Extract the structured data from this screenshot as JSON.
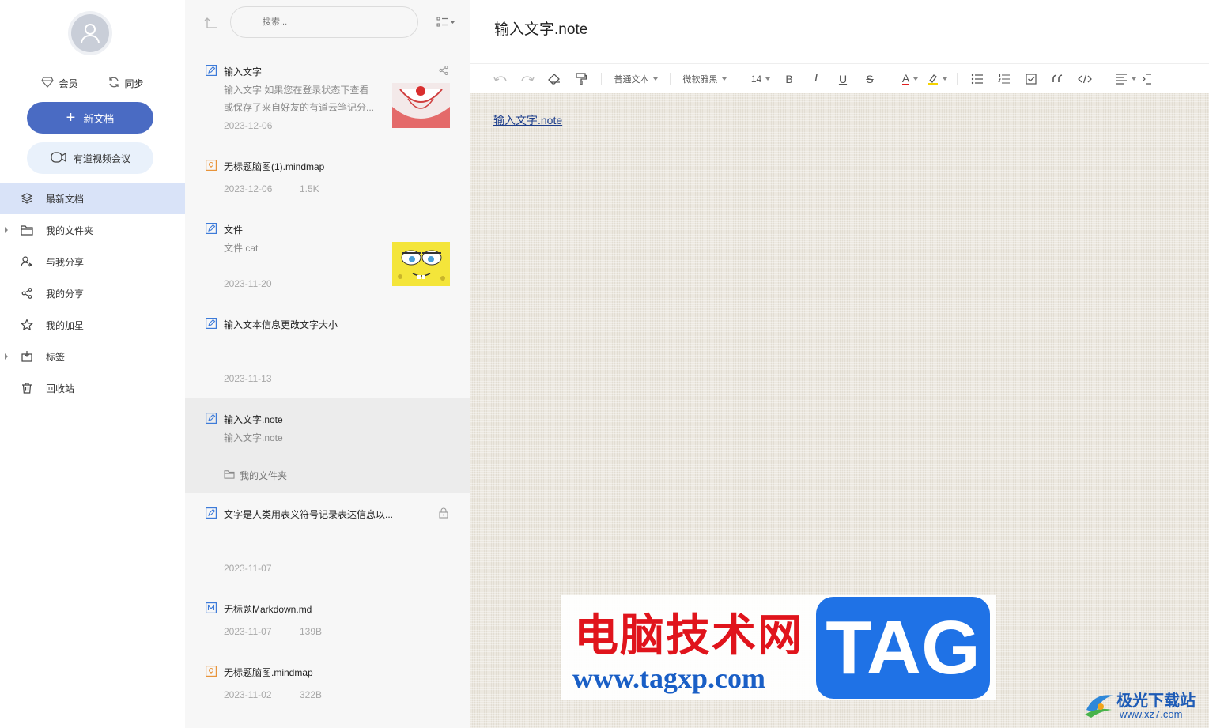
{
  "sidebar": {
    "member_label": "会员",
    "sync_label": "同步",
    "new_doc_label": "新文档",
    "meeting_label": "有道视频会议",
    "nav": [
      {
        "label": "最新文档",
        "icon": "layers-icon",
        "active": true
      },
      {
        "label": "我的文件夹",
        "icon": "folder-icon",
        "expandable": true
      },
      {
        "label": "与我分享",
        "icon": "shared-with-me-icon"
      },
      {
        "label": "我的分享",
        "icon": "share-icon"
      },
      {
        "label": "我的加星",
        "icon": "star-icon"
      },
      {
        "label": "标签",
        "icon": "tag-icon",
        "expandable": true
      },
      {
        "label": "回收站",
        "icon": "trash-icon"
      }
    ]
  },
  "list": {
    "search_placeholder": "搜索...",
    "notes": [
      {
        "title": "输入文字",
        "snippet": "输入文字 如果您在登录状态下查看或保存了来自好友的有道云笔记分...",
        "date": "2023-12-06",
        "icon": "note-icon"
      },
      {
        "title": "无标题脑图(1).mindmap",
        "date": "2023-12-06",
        "size": "1.5K",
        "icon": "mindmap-icon"
      },
      {
        "title": "文件",
        "snippet": "文件 cat",
        "date": "2023-11-20",
        "icon": "note-icon"
      },
      {
        "title": "输入文本信息更改文字大小",
        "date": "2023-11-13",
        "icon": "note-icon"
      },
      {
        "title": "输入文字.note",
        "snippet": "输入文字.note",
        "folder": "我的文件夹",
        "icon": "note-icon",
        "selected": true
      },
      {
        "title": "文字是人类用表义符号记录表达信息以...",
        "date": "2023-11-07",
        "icon": "note-icon",
        "locked": true
      },
      {
        "title": "无标题Markdown.md",
        "date": "2023-11-07",
        "size": "139B",
        "icon": "markdown-icon"
      },
      {
        "title": "无标题脑图.mindmap",
        "date": "2023-11-02",
        "size": "322B",
        "icon": "mindmap-icon"
      }
    ]
  },
  "editor": {
    "title": "输入文字.note",
    "toolbar": {
      "paragraph_style": "普通文本",
      "font": "微软雅黑",
      "font_size": "14",
      "bold": "B",
      "italic": "I",
      "underline": "U",
      "strike": "S",
      "font_color": "A"
    },
    "body_text": "输入文字.note"
  },
  "watermark": {
    "cn": "电脑技术网",
    "url": "www.tagxp.com",
    "tag": "TAG",
    "corner_cn": "极光下载站",
    "corner_url": "www.xz7.com"
  },
  "colors": {
    "accent": "#4a6bc3",
    "active_nav": "#d9e3f8",
    "list_bg": "#f7f7f7",
    "link": "#1e3f8c"
  }
}
